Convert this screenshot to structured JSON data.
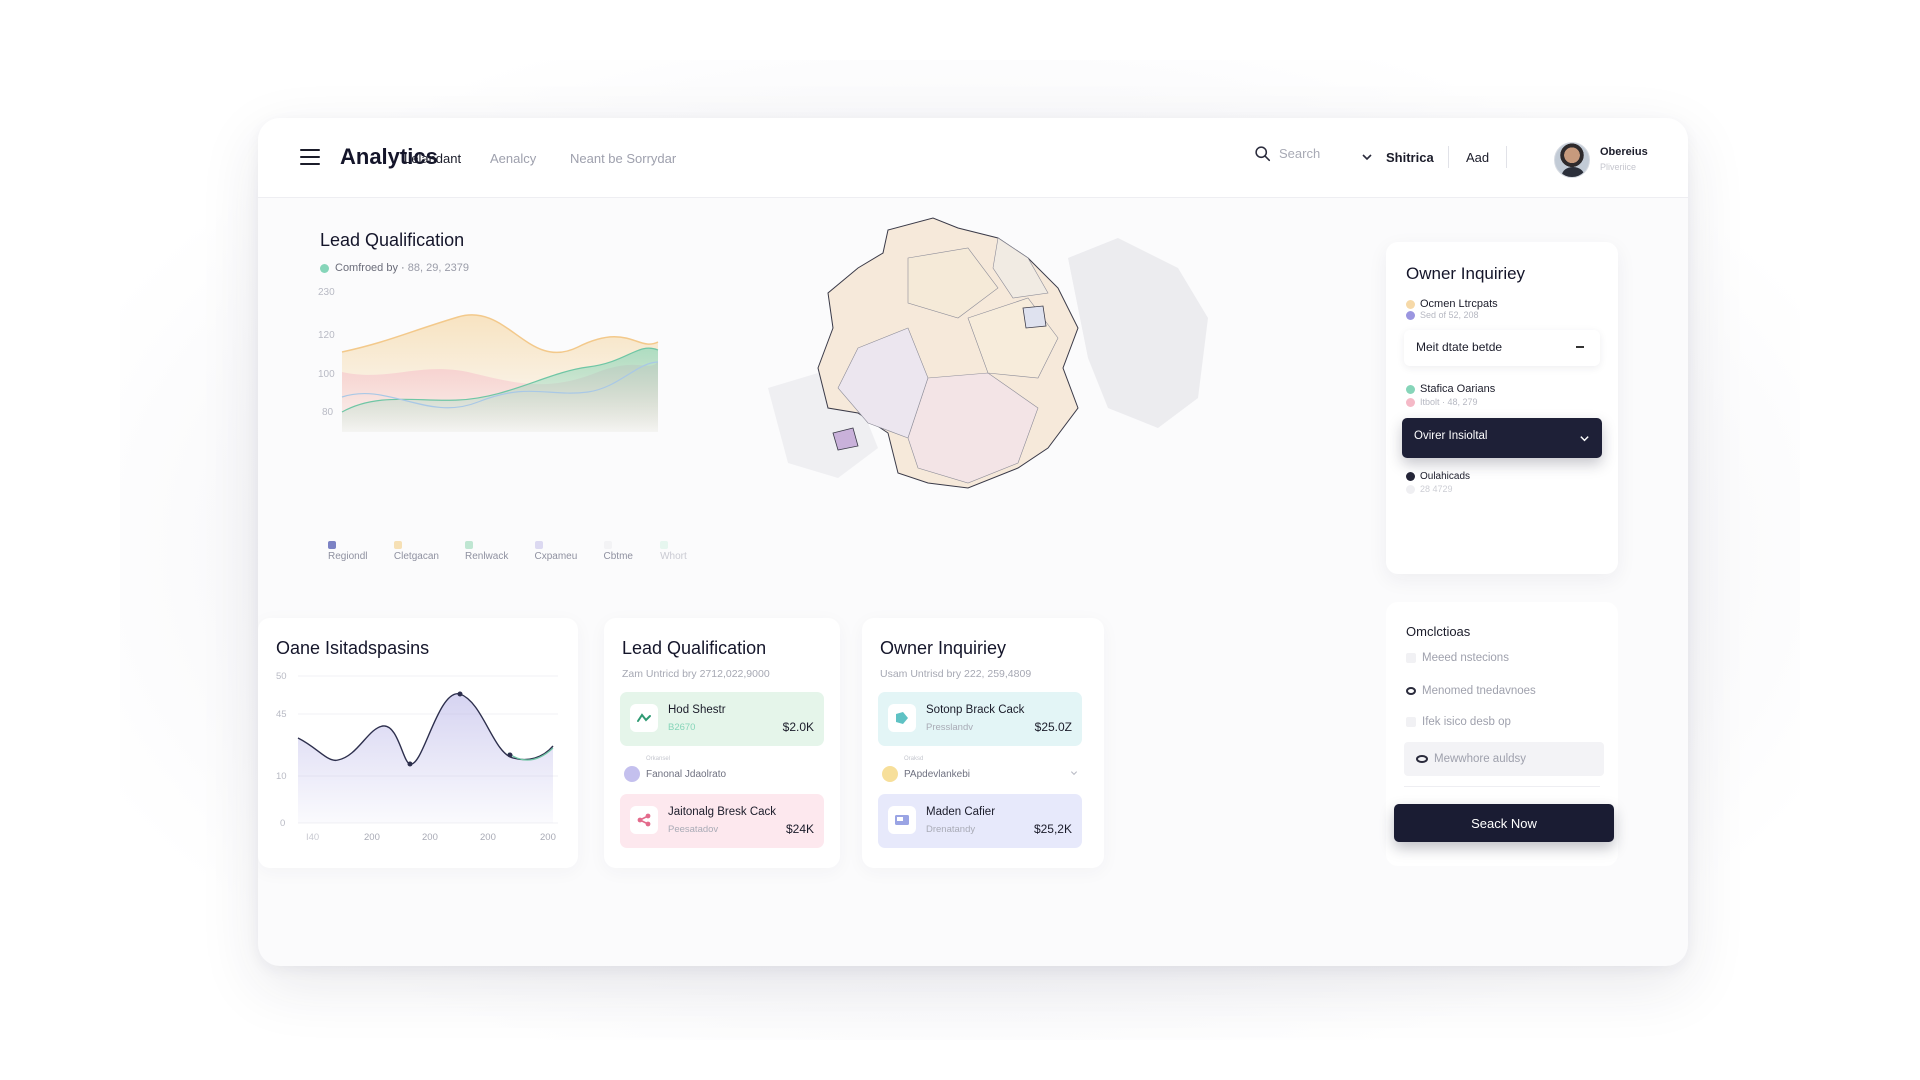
{
  "app": {
    "title": "Analytics"
  },
  "nav": {
    "items": [
      "Lelandant",
      "Aenalcy",
      "Neant be Sorrydar"
    ]
  },
  "search": {
    "placeholder": "Search"
  },
  "top_links": [
    "Shitrica",
    "Aad"
  ],
  "user": {
    "name": "Obereius",
    "role": "Pliveriice"
  },
  "lead_top": {
    "title": "Lead Qualification",
    "subline_label": "Comfroed by",
    "subline_value": "88, 29, 2379",
    "y_ticks": [
      "230",
      "120",
      "100",
      "80"
    ],
    "legend": [
      "Regiondl",
      "Cletgacan",
      "Renlwack",
      "Cxpameu",
      "Cbtme",
      "Whort"
    ]
  },
  "owner_side": {
    "title": "Owner Inquiriey",
    "items": [
      {
        "label": "Ocmen Ltrcpats",
        "sub": "Sed of 52, 208"
      },
      {
        "label": "Stafica Oarians",
        "sub": "Itbolt · 48, 279"
      },
      {
        "label": "Oulahicads",
        "sub": "28 4729"
      }
    ],
    "select_light": "Meit dtate betde",
    "select_dark": "Ovirer Insioltal"
  },
  "options_card": {
    "title": "Omclctioas",
    "options": [
      "Meeed nstecions",
      "Menomed tnedavnoes",
      "Ifek isico desb op",
      "Mewwhore auldsy"
    ],
    "cta": "Seack Now"
  },
  "oane": {
    "title": "Oane Isitadspasins",
    "y_ticks": [
      "50",
      "45",
      "10",
      "0"
    ],
    "x_ticks": [
      "I40",
      "200",
      "200",
      "200",
      "200"
    ]
  },
  "lead_bottom": {
    "title": "Lead Qualification",
    "subline": "Zam Untricd bry 2712,022,9000",
    "tiles": [
      {
        "name": "Hod Shestr",
        "sub": "B2670",
        "value": "$2.0K"
      },
      {
        "name": "Jaitonalg Bresk Cack",
        "sub": "Peesatadov",
        "value": "$24K"
      }
    ],
    "mid_label": "Fanonal Jdaolrato",
    "mid_tiny": "Orkansel"
  },
  "owner_bottom": {
    "title": "Owner Inquiriey",
    "subline": "Usam Untrisd bry 222, 259,4809",
    "tiles": [
      {
        "name": "Sotonp Brack Cack",
        "sub": "Presslandv",
        "value": "$25.0Z"
      },
      {
        "name": "Maden Cafier",
        "sub": "Drenatandy",
        "value": "$25,2K"
      }
    ],
    "mid_label": "PApdevlankebi",
    "mid_tiny": "Oraksd"
  },
  "colors": {
    "accent_dark": "#1e2037",
    "mint": "#86d5b9",
    "peach": "#f6d9a8",
    "pink": "#f5b9c7",
    "lavender": "#b4b0e6"
  }
}
